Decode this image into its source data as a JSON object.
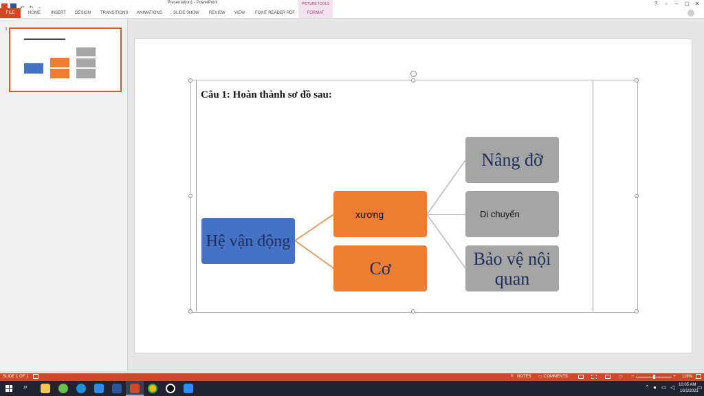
{
  "window": {
    "title": "Presentation1 - PowerPoint",
    "context_group": "PICTURE TOOLS",
    "controls": [
      "?",
      "▫",
      "–",
      "▢",
      "✕"
    ]
  },
  "ribbon": {
    "file": "FILE",
    "tabs": [
      "HOME",
      "INSERT",
      "DESIGN",
      "TRANSITIONS",
      "ANIMATIONS",
      "SLIDE SHOW",
      "REVIEW",
      "VIEW",
      "FOXIT READER PDF"
    ],
    "format": "FORMAT"
  },
  "thumbnails": {
    "number": "1"
  },
  "slide": {
    "title": "Câu 1: Hoàn thành sơ đồ sau:",
    "root": "Hệ vận động",
    "bone": "xương",
    "muscle": "Cơ",
    "support": "Nâng đỡ",
    "move": "Di chuyển",
    "protect": "Bảo vệ nội quan"
  },
  "statusbar": {
    "slide_info": "SLIDE 1 OF 1",
    "notes": "NOTES",
    "comments": "COMMENTS",
    "zoom": "119%"
  },
  "taskbar": {
    "time": "10:05 AM",
    "date": "10/1/2021"
  },
  "colors": {
    "accent": "#d24726",
    "root_fill": "#4472c4",
    "orange_fill": "#ed7d31",
    "gray_fill": "#a5a5a5"
  }
}
